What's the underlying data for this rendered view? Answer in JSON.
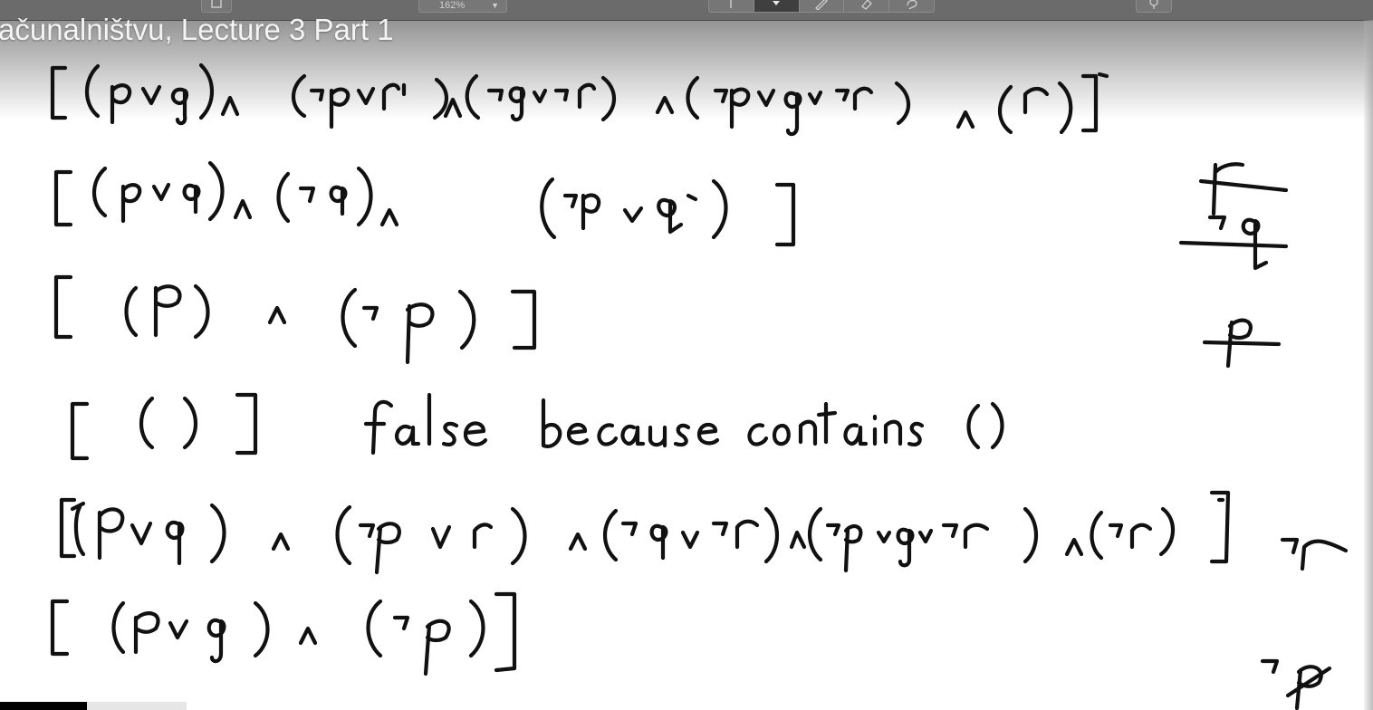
{
  "video": {
    "title": "ačunalništvu, Lecture 3 Part 1"
  },
  "toolbar": {
    "zoom_label": "162%",
    "zoom_icon": "chevron-down-icon",
    "tools": [
      "pointer-icon",
      "pen-icon",
      "highlighter-icon",
      "eraser-icon",
      "lasso-icon"
    ]
  },
  "whiteboard": {
    "lines": [
      "[(p∨q)∧(¬p∨r)∧(¬q∨¬r)∧(¬p∨q∨¬r)∧(r)]",
      "[(p∨q)∧(¬q)∧(¬p∨q)]",
      "[(p)∧(¬p)]",
      "[()]",
      "[(p∨q)∧(¬p∨r)∧(¬q∨¬r)∧(¬p∨q∨¬r)∧(¬r)]",
      "[(p∨q)∧(¬p)]"
    ],
    "note_line4": "false because contains ()",
    "margin_notes": [
      "r",
      "¬q",
      "p",
      "¬r",
      "¬p"
    ]
  }
}
